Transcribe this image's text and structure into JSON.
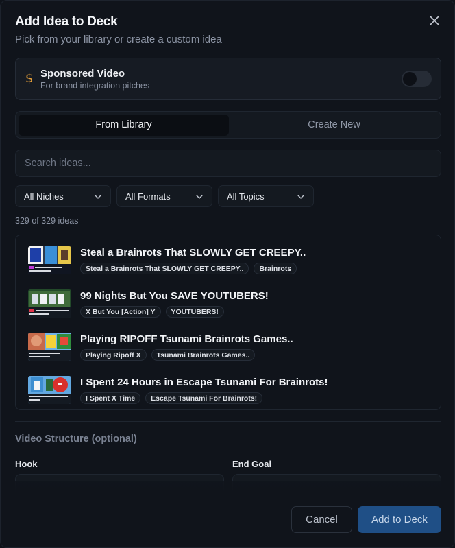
{
  "modal": {
    "title": "Add Idea to Deck",
    "subtitle": "Pick from your library or create a custom idea",
    "close_icon": "close-icon"
  },
  "sponsored": {
    "icon": "dollar-icon",
    "title": "Sponsored Video",
    "subtitle": "For brand integration pitches",
    "toggle_on": false,
    "icon_color": "#e8a13a"
  },
  "tabs": [
    {
      "label": "From Library",
      "active": true
    },
    {
      "label": "Create New",
      "active": false
    }
  ],
  "search": {
    "placeholder": "Search ideas...",
    "value": ""
  },
  "filters": [
    {
      "label": "All Niches"
    },
    {
      "label": "All Formats"
    },
    {
      "label": "All Topics"
    }
  ],
  "count_text": "329 of 329 ideas",
  "ideas": [
    {
      "title": "Steal a Brainrots That SLOWLY GET CREEPY..",
      "tags": [
        "Steal a Brainrots That SLOWLY GET CREEPY..",
        "Brainrots"
      ]
    },
    {
      "title": "99 Nights But You SAVE YOUTUBERS!",
      "tags": [
        "X But You [Action] Y",
        "YOUTUBERS!"
      ]
    },
    {
      "title": "Playing RIPOFF Tsunami Brainrots Games..",
      "tags": [
        "Playing Ripoff X",
        "Tsunami Brainrots Games.."
      ]
    },
    {
      "title": "I Spent 24 Hours in Escape Tsunami For Brainrots!",
      "tags": [
        "I Spent X Time",
        "Escape Tsunami For Brainrots!"
      ]
    }
  ],
  "video_structure": {
    "title": "Video Structure (optional)",
    "hook_label": "Hook",
    "end_goal_label": "End Goal"
  },
  "footer": {
    "cancel": "Cancel",
    "add": "Add to Deck",
    "accent": "#1f4f86"
  }
}
